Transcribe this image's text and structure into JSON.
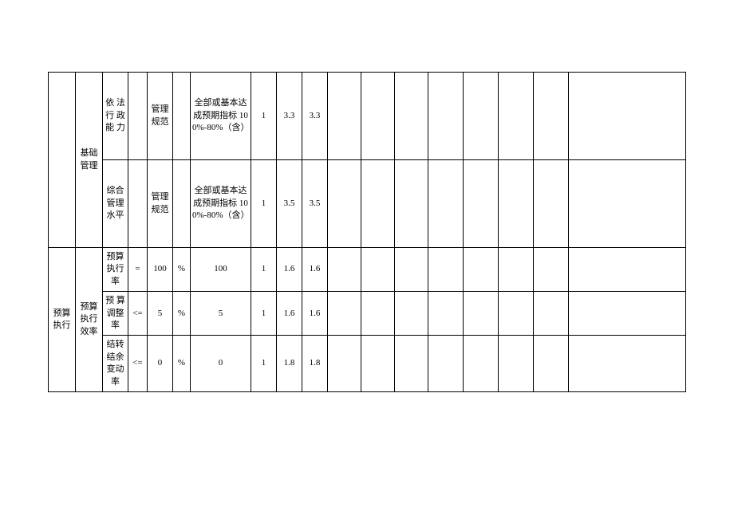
{
  "table": {
    "rows": [
      {
        "c0": "",
        "c1": "基础管理",
        "c2": "依 法行 政能 力",
        "c3": "",
        "c4": "管理规范",
        "c5": "",
        "c6": "全部或基本达成预期指标 100%-80%（含）",
        "c7": "1",
        "c8": "3.3",
        "c9": "3.3",
        "c10": "",
        "c11": "",
        "c12": "",
        "c13": "",
        "c14": "",
        "c15": "",
        "c16": "",
        "c17": ""
      },
      {
        "c2": "综合管理水平",
        "c3": "",
        "c4": "管理规范",
        "c5": "",
        "c6": "全部或基本达成预期指标 100%-80%（含）",
        "c7": "1",
        "c8": "3.5",
        "c9": "3.5",
        "c10": "",
        "c11": "",
        "c12": "",
        "c13": "",
        "c14": "",
        "c15": "",
        "c16": "",
        "c17": ""
      },
      {
        "c0": "预算执行",
        "c1": "预算执行效率",
        "c2": "预算执行率",
        "c3": "=",
        "c4": "100",
        "c5": "%",
        "c6": "100",
        "c7": "1",
        "c8": "1.6",
        "c9": "1.6",
        "c10": "",
        "c11": "",
        "c12": "",
        "c13": "",
        "c14": "",
        "c15": "",
        "c16": "",
        "c17": ""
      },
      {
        "c2": "预 算调整率",
        "c3": "<=",
        "c4": "5",
        "c5": "%",
        "c6": "5",
        "c7": "1",
        "c8": "1.6",
        "c9": "1.6",
        "c10": "",
        "c11": "",
        "c12": "",
        "c13": "",
        "c14": "",
        "c15": "",
        "c16": "",
        "c17": ""
      },
      {
        "c2": "结转结余变动率",
        "c3": "<=",
        "c4": "0",
        "c5": "%",
        "c6": "0",
        "c7": "1",
        "c8": "1.8",
        "c9": "1.8",
        "c10": "",
        "c11": "",
        "c12": "",
        "c13": "",
        "c14": "",
        "c15": "",
        "c16": "",
        "c17": ""
      }
    ]
  }
}
